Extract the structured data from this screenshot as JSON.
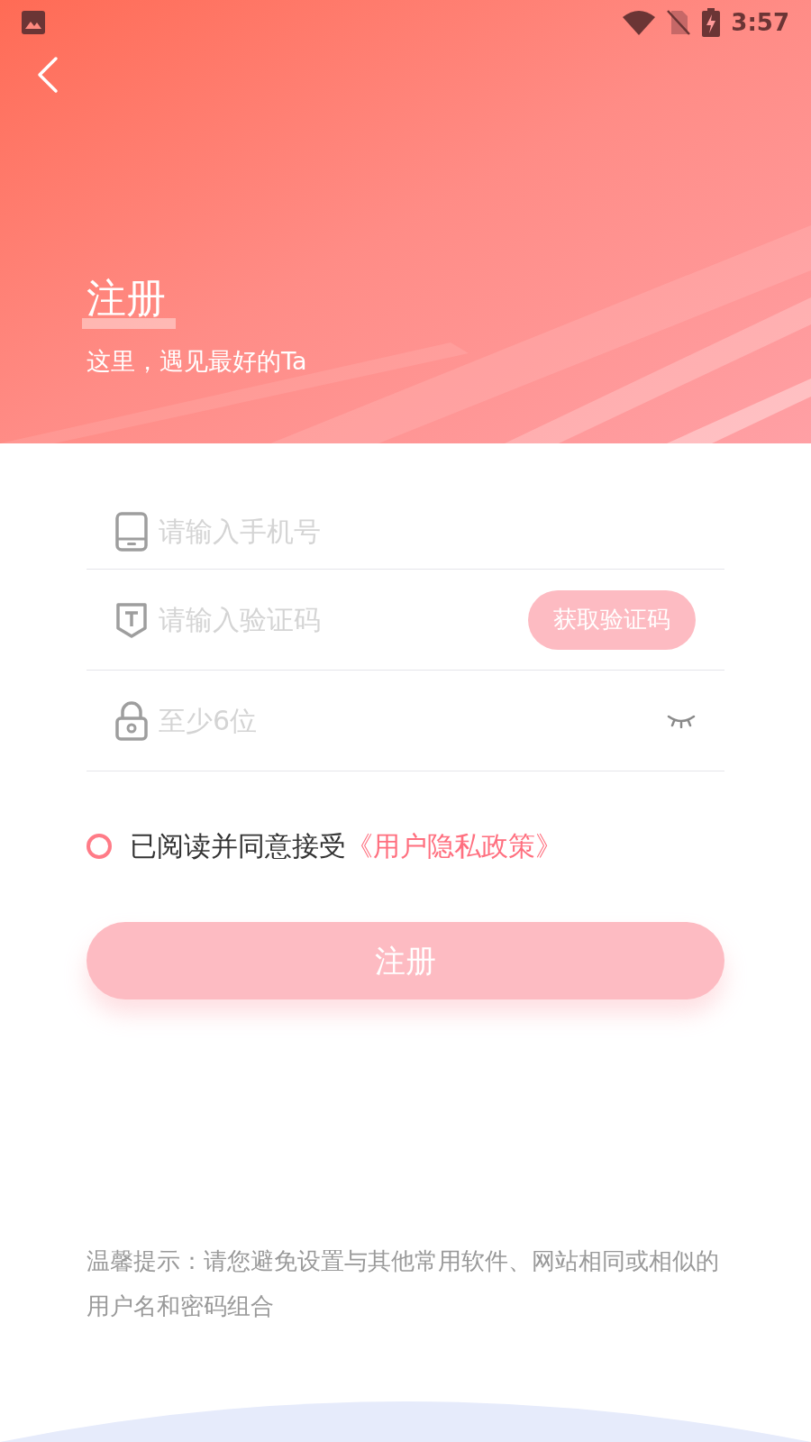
{
  "status_bar": {
    "time": "3:57"
  },
  "header": {
    "title": "注册",
    "subtitle": "这里，遇见最好的Ta"
  },
  "fields": [
    {
      "kind": "phone",
      "placeholder": "请输入手机号"
    },
    {
      "kind": "code",
      "placeholder": "请输入验证码",
      "button": "获取验证码"
    },
    {
      "kind": "password",
      "placeholder": "至少6位"
    }
  ],
  "agreement": {
    "checked": false,
    "text": "已阅读并同意接受",
    "link": "《用户隐私政策》"
  },
  "submit": {
    "label": "注册"
  },
  "tip": "温馨提示：请您避免设置与其他常用软件、网站相同或相似的用户名和密码组合"
}
